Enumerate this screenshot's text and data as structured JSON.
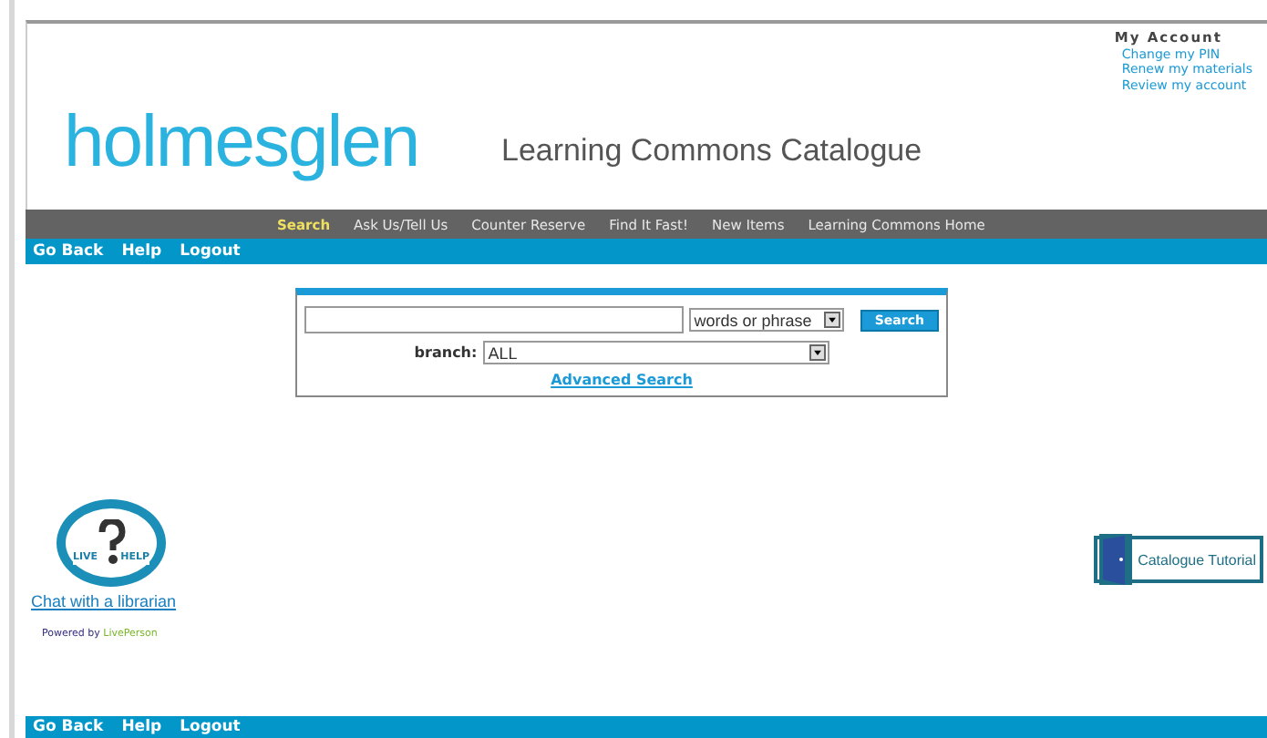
{
  "logo": "holmesglen",
  "header_title": "Learning Commons Catalogue",
  "account": {
    "title": "My Account",
    "links": [
      "Change my PIN",
      "Renew my materials",
      "Review my account"
    ]
  },
  "nav": [
    {
      "label": "Search",
      "selected": true
    },
    {
      "label": "Ask Us/Tell Us",
      "selected": false
    },
    {
      "label": "Counter Reserve",
      "selected": false
    },
    {
      "label": "Find It Fast!",
      "selected": false
    },
    {
      "label": "New Items",
      "selected": false
    },
    {
      "label": "Learning Commons Home",
      "selected": false
    }
  ],
  "top_links": [
    "Go Back",
    "Help",
    "Logout"
  ],
  "search": {
    "mode": "words or phrase",
    "button": "Search",
    "branch_label": "branch:",
    "branch": "ALL",
    "advanced": "Advanced Search"
  },
  "live_help": {
    "badge_left": "LIVE",
    "badge_right": "HELP",
    "link": "Chat with a librarian",
    "powered": "Powered by",
    "vendor": "LivePerson"
  },
  "tutorial": "Catalogue Tutorial",
  "bottom_links": [
    "Go Back",
    "Help",
    "Logout"
  ]
}
